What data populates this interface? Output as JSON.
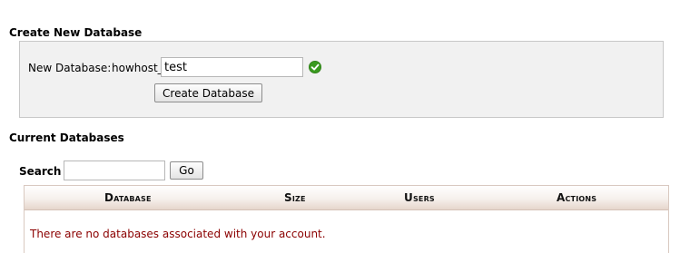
{
  "create_section": {
    "title": "Create New Database",
    "new_database_label": "New Database:",
    "prefix": "howhost_",
    "database_name_value": "test",
    "create_button_label": "Create Database",
    "validation_status": "valid",
    "validation_color": "#3a9a1f"
  },
  "current_section": {
    "title": "Current Databases",
    "search_label": "Search",
    "search_value": "",
    "go_button_label": "Go",
    "table": {
      "headers": [
        "Database",
        "Size",
        "Users",
        "Actions"
      ],
      "empty_message": "There are no databases associated with your account."
    }
  },
  "colors": {
    "empty_message": "#8b0000",
    "panel_background": "#f1f1f1",
    "table_header_tint": "#e6d6cc"
  },
  "icons": {
    "validation": "check-circle-icon"
  }
}
